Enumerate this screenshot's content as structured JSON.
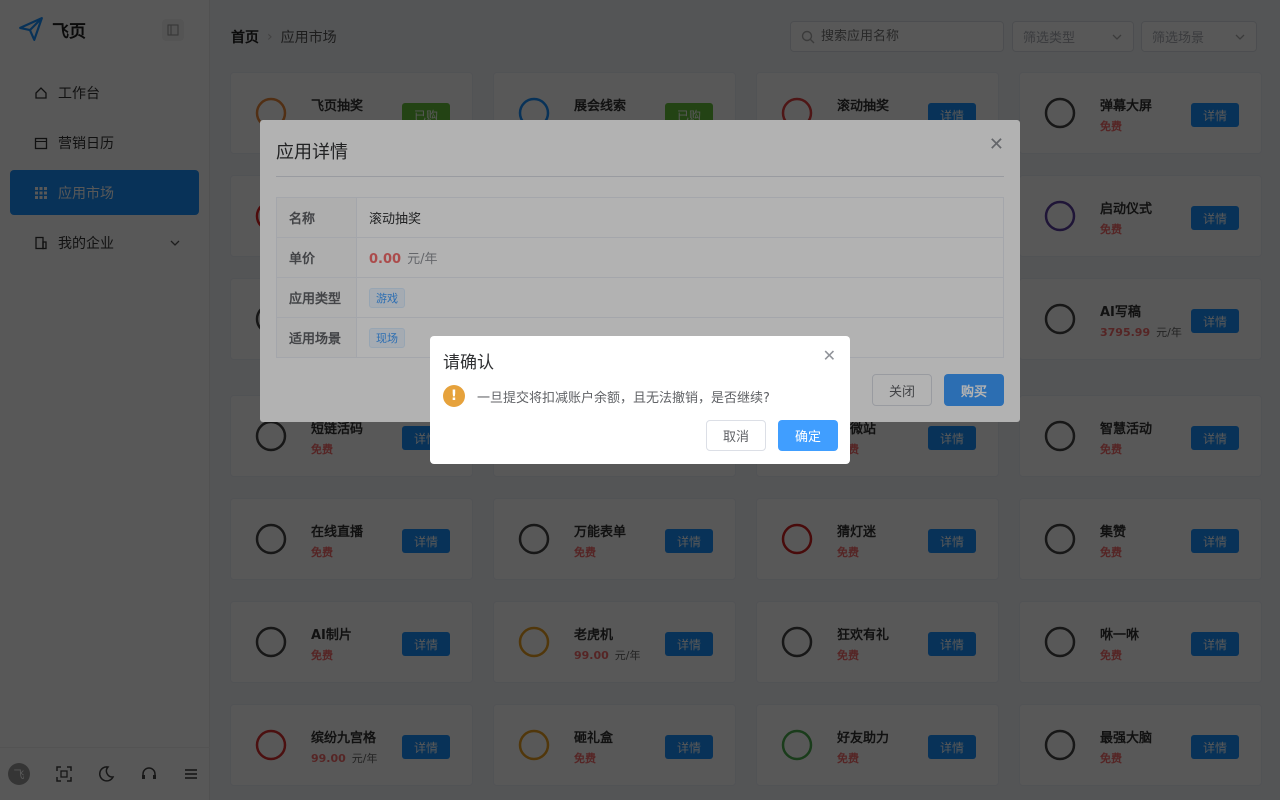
{
  "app": {
    "logo_text": "飞页"
  },
  "sidebar": {
    "items": [
      {
        "label": "工作台",
        "icon": "home-icon"
      },
      {
        "label": "营销日历",
        "icon": "calendar-icon"
      },
      {
        "label": "应用市场",
        "icon": "grid-icon",
        "active": true
      },
      {
        "label": "我的企业",
        "icon": "building-icon"
      }
    ],
    "avatar_text": "飞"
  },
  "breadcrumb": {
    "home": "首页",
    "current": "应用市场"
  },
  "search": {
    "placeholder": "搜索应用名称"
  },
  "filters": {
    "type_placeholder": "筛选类型",
    "scene_placeholder": "筛选场景"
  },
  "cards": [
    {
      "name": "飞页抽奖",
      "price": "",
      "unit": "",
      "btn": "已购",
      "bought": true,
      "icon": "wheel-icon",
      "icon_color": "#e8883a"
    },
    {
      "name": "展会线索",
      "price": "",
      "unit": "",
      "btn": "已购",
      "bought": true,
      "icon": "exhibit-icon",
      "icon_color": "#1890ff"
    },
    {
      "name": "滚动抽奖",
      "price": "",
      "unit": "",
      "btn": "详情",
      "icon": "gift-box-icon",
      "icon_color": "#e04040"
    },
    {
      "name": "弹幕大屏",
      "price": "免费",
      "unit": "",
      "btn": "详情",
      "icon": "danmu-icon",
      "icon_color": "#444"
    },
    {
      "name": "",
      "price": "",
      "unit": "",
      "btn": "详情",
      "icon": "red-icon",
      "icon_color": "#e02020"
    },
    {
      "name": "",
      "price": "",
      "unit": "",
      "btn": "详情",
      "icon": "blank-icon",
      "icon_color": "#fff"
    },
    {
      "name": "",
      "price": "",
      "unit": "",
      "btn": "详情",
      "icon": "blank-icon",
      "icon_color": "#fff"
    },
    {
      "name": "启动仪式",
      "price": "免费",
      "unit": "",
      "btn": "详情",
      "icon": "launch-button-icon",
      "icon_color": "#5b3fa0"
    },
    {
      "name": "",
      "price": "",
      "unit": "",
      "btn": "详情",
      "icon": "phone-icon",
      "icon_color": "#444"
    },
    {
      "name": "",
      "price": "",
      "unit": "",
      "btn": "详情",
      "icon": "blank-icon",
      "icon_color": "#fff"
    },
    {
      "name": "",
      "price": "",
      "unit": "",
      "btn": "详情",
      "icon": "blank-icon",
      "icon_color": "#fff"
    },
    {
      "name": "AI写稿",
      "price": "3795.99",
      "unit": "元/年",
      "btn": "详情",
      "icon": "ai-chip-icon",
      "icon_color": "#444"
    },
    {
      "name": "短链活码",
      "price": "免费",
      "unit": "",
      "btn": "详情",
      "icon": "qr-grid-icon",
      "icon_color": "#444"
    },
    {
      "name": "",
      "price": "",
      "unit": "",
      "btn": "详情",
      "icon": "blank-icon",
      "icon_color": "#fff"
    },
    {
      "name": "炫微站",
      "price": "免费",
      "unit": "",
      "btn": "详情",
      "icon": "blank-icon",
      "icon_color": "#fff"
    },
    {
      "name": "智慧活动",
      "price": "免费",
      "unit": "",
      "btn": "详情",
      "icon": "flag-circle-icon",
      "icon_color": "#444"
    },
    {
      "name": "在线直播",
      "price": "免费",
      "unit": "",
      "btn": "详情",
      "icon": "tv-play-icon",
      "icon_color": "#444"
    },
    {
      "name": "万能表单",
      "price": "免费",
      "unit": "",
      "btn": "详情",
      "icon": "form-list-icon",
      "icon_color": "#444"
    },
    {
      "name": "猜灯迷",
      "price": "免费",
      "unit": "",
      "btn": "详情",
      "icon": "lantern-icon",
      "icon_color": "#d02020"
    },
    {
      "name": "集赞",
      "price": "免费",
      "unit": "",
      "btn": "详情",
      "icon": "like-circle-icon",
      "icon_color": "#444"
    },
    {
      "name": "AI制片",
      "price": "免费",
      "unit": "",
      "btn": "详情",
      "icon": "film-icon",
      "icon_color": "#444"
    },
    {
      "name": "老虎机",
      "price": "99.00",
      "unit": "元/年",
      "btn": "详情",
      "icon": "gift-icon",
      "icon_color": "#e8a020"
    },
    {
      "name": "狂欢有礼",
      "price": "免费",
      "unit": "",
      "btn": "详情",
      "icon": "present-icon",
      "icon_color": "#444"
    },
    {
      "name": "咻一咻",
      "price": "免费",
      "unit": "",
      "btn": "详情",
      "icon": "send-icon",
      "icon_color": "#444"
    },
    {
      "name": "缤纷九宫格",
      "price": "99.00",
      "unit": "元/年",
      "btn": "详情",
      "icon": "red-gift-icon",
      "icon_color": "#d83030"
    },
    {
      "name": "砸礼盒",
      "price": "免费",
      "unit": "",
      "btn": "详情",
      "icon": "gold-box-icon",
      "icon_color": "#e8a020"
    },
    {
      "name": "好友助力",
      "price": "免费",
      "unit": "",
      "btn": "详情",
      "icon": "handshake-icon",
      "icon_color": "#4caf50"
    },
    {
      "name": "最强大脑",
      "price": "免费",
      "unit": "",
      "btn": "详情",
      "icon": "brain-icon",
      "icon_color": "#444"
    }
  ],
  "detail": {
    "title": "应用详情",
    "rows": [
      {
        "label": "名称",
        "value": "滚动抽奖"
      },
      {
        "label": "单价",
        "price": "0.00",
        "unit": "元/年"
      },
      {
        "label": "应用类型",
        "tag": "游戏"
      },
      {
        "label": "适用场景",
        "tag": "现场"
      }
    ],
    "close_label": "关闭",
    "buy_label": "购买"
  },
  "confirm": {
    "title": "请确认",
    "message": "一旦提交将扣减账户余额，且无法撤销，是否继续?",
    "cancel_label": "取消",
    "ok_label": "确定"
  }
}
